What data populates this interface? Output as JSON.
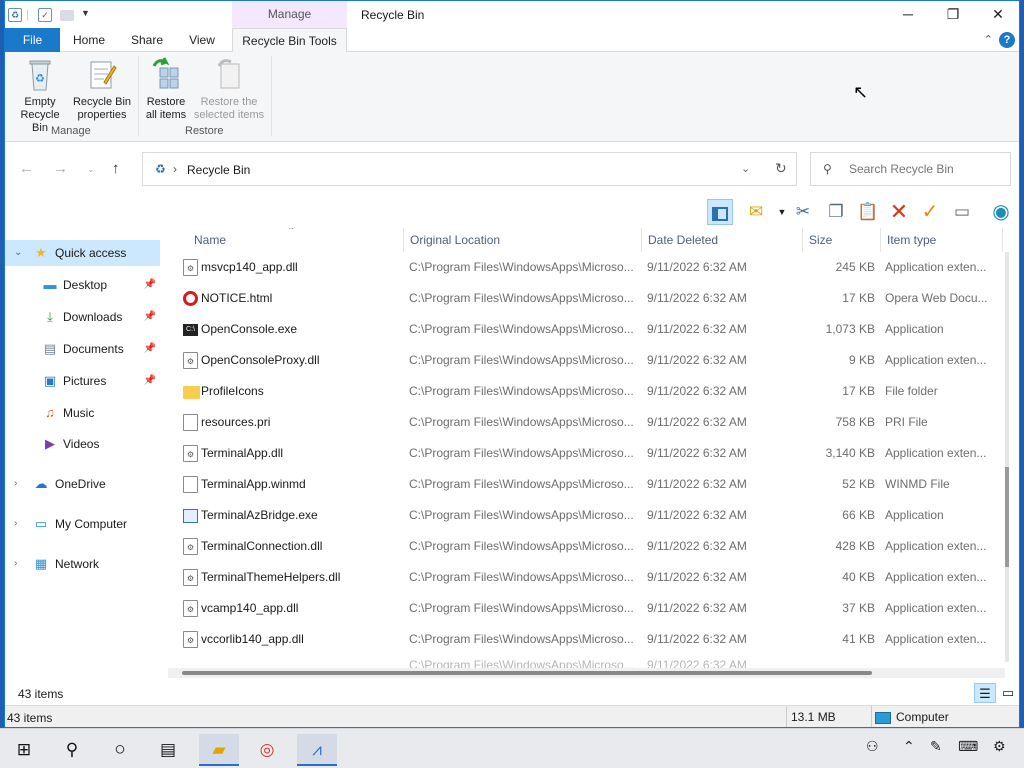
{
  "window": {
    "title": "Recycle Bin",
    "context_tab_group": "Manage",
    "minimize": "─",
    "maximize": "❐",
    "close": "✕"
  },
  "ribbon_tabs": {
    "file": "File",
    "home": "Home",
    "share": "Share",
    "view": "View",
    "recycle_bin_tools": "Recycle Bin Tools",
    "help": "?"
  },
  "ribbon": {
    "empty_line1": "Empty",
    "empty_line2": "Recycle Bin",
    "props_line1": "Recycle Bin",
    "props_line2": "properties",
    "manage_label": "Manage",
    "restore_all_line1": "Restore",
    "restore_all_line2": "all items",
    "restore_sel_line1": "Restore the",
    "restore_sel_line2": "selected items",
    "restore_label": "Restore"
  },
  "address": {
    "path": "Recycle Bin",
    "search_placeholder": "Search Recycle Bin"
  },
  "nav": {
    "quick_access": "Quick access",
    "desktop": "Desktop",
    "downloads": "Downloads",
    "documents": "Documents",
    "pictures": "Pictures",
    "music": "Music",
    "videos": "Videos",
    "onedrive": "OneDrive",
    "my_computer": "My Computer",
    "network": "Network"
  },
  "columns": {
    "name": "Name",
    "original_location": "Original Location",
    "date_deleted": "Date Deleted",
    "size": "Size",
    "item_type": "Item type"
  },
  "files": [
    {
      "name": "msvcp140_app.dll",
      "location": "C:\\Program Files\\WindowsApps\\Microso...",
      "date": "9/11/2022 6:32 AM",
      "size": "245 KB",
      "type": "Application exten...",
      "icon": "dll"
    },
    {
      "name": "NOTICE.html",
      "location": "C:\\Program Files\\WindowsApps\\Microso...",
      "date": "9/11/2022 6:32 AM",
      "size": "17 KB",
      "type": "Opera Web Docu...",
      "icon": "opera"
    },
    {
      "name": "OpenConsole.exe",
      "location": "C:\\Program Files\\WindowsApps\\Microso...",
      "date": "9/11/2022 6:32 AM",
      "size": "1,073 KB",
      "type": "Application",
      "icon": "console"
    },
    {
      "name": "OpenConsoleProxy.dll",
      "location": "C:\\Program Files\\WindowsApps\\Microso...",
      "date": "9/11/2022 6:32 AM",
      "size": "9 KB",
      "type": "Application exten...",
      "icon": "dll"
    },
    {
      "name": "ProfileIcons",
      "location": "C:\\Program Files\\WindowsApps\\Microso...",
      "date": "9/11/2022 6:32 AM",
      "size": "17 KB",
      "type": "File folder",
      "icon": "folder"
    },
    {
      "name": "resources.pri",
      "location": "C:\\Program Files\\WindowsApps\\Microso...",
      "date": "9/11/2022 6:32 AM",
      "size": "758 KB",
      "type": "PRI File",
      "icon": "doc"
    },
    {
      "name": "TerminalApp.dll",
      "location": "C:\\Program Files\\WindowsApps\\Microso...",
      "date": "9/11/2022 6:32 AM",
      "size": "3,140 KB",
      "type": "Application exten...",
      "icon": "dll"
    },
    {
      "name": "TerminalApp.winmd",
      "location": "C:\\Program Files\\WindowsApps\\Microso...",
      "date": "9/11/2022 6:32 AM",
      "size": "52 KB",
      "type": "WINMD File",
      "icon": "doc"
    },
    {
      "name": "TerminalAzBridge.exe",
      "location": "C:\\Program Files\\WindowsApps\\Microso...",
      "date": "9/11/2022 6:32 AM",
      "size": "66 KB",
      "type": "Application",
      "icon": "exe"
    },
    {
      "name": "TerminalConnection.dll",
      "location": "C:\\Program Files\\WindowsApps\\Microso...",
      "date": "9/11/2022 6:32 AM",
      "size": "428 KB",
      "type": "Application exten...",
      "icon": "dll"
    },
    {
      "name": "TerminalThemeHelpers.dll",
      "location": "C:\\Program Files\\WindowsApps\\Microso...",
      "date": "9/11/2022 6:32 AM",
      "size": "40 KB",
      "type": "Application exten...",
      "icon": "dll"
    },
    {
      "name": "vcamp140_app.dll",
      "location": "C:\\Program Files\\WindowsApps\\Microso...",
      "date": "9/11/2022 6:32 AM",
      "size": "37 KB",
      "type": "Application exten...",
      "icon": "dll"
    },
    {
      "name": "vccorlib140_app.dll",
      "location": "C:\\Program Files\\WindowsApps\\Microso...",
      "date": "9/11/2022 6:32 AM",
      "size": "41 KB",
      "type": "Application exten...",
      "icon": "dll"
    }
  ],
  "status": {
    "item_count": "43 items",
    "bottom_count": "43 items",
    "total_size": "13.1 MB",
    "zone": "Computer"
  },
  "colors": {
    "accent": "#1979ca",
    "context_tab": "#f3e8ff",
    "nav_selected": "#cce8ff",
    "desktop_bg": "#1e5fb4"
  }
}
